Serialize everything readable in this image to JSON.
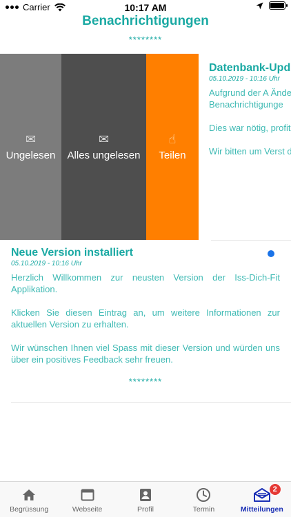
{
  "status_bar": {
    "carrier": "Carrier",
    "time": "10:17 AM"
  },
  "header": {
    "title": "Benachrichtigungen",
    "stars": "********"
  },
  "swipe_actions": [
    {
      "label": "Ungelesen",
      "icon": "envelope-icon",
      "color": "#7c7c7c"
    },
    {
      "label": "Alles ungelesen",
      "icon": "envelope-icon",
      "color": "#4e4e4e"
    },
    {
      "label": "Teilen",
      "icon": "hand-pointer-icon",
      "color": "#ff7f00"
    }
  ],
  "notifications": [
    {
      "title": "Datenbank-Upd",
      "date": "05.10.2019 - 10:16 Uhr",
      "body": [
        "Aufgrund der A Änderungen in vorgenommen wer Benachrichtigunge",
        "Dies war nötig, profitieren können.",
        "Wir bitten um Verst dieser Version."
      ]
    },
    {
      "title": "Neue Version installiert",
      "date": "05.10.2019 - 10:16 Uhr",
      "unread": true,
      "body": [
        "Herzlich Willkommen zur neusten Version der Iss-Dich-Fit Applikation.",
        "Klicken Sie diesen Eintrag an, um weitere Informationen zur aktuellen Version zu erhalten.",
        "Wir wünschen Ihnen viel Spass mit dieser Version und würden uns über ein positives Feedback sehr freuen."
      ],
      "stars": "********"
    }
  ],
  "tabs": [
    {
      "label": "Begrüssung",
      "icon": "home-icon",
      "active": false
    },
    {
      "label": "Webseite",
      "icon": "browser-window-icon",
      "active": false
    },
    {
      "label": "Profil",
      "icon": "profile-card-icon",
      "active": false
    },
    {
      "label": "Termin",
      "icon": "clock-icon",
      "active": false
    },
    {
      "label": "Mitteilungen",
      "icon": "mail-icon",
      "active": true,
      "badge": "2"
    }
  ],
  "colors": {
    "accent": "#1aa9a3",
    "tab_active": "#1a2fb5",
    "share_action": "#ff7f00",
    "badge": "#e53935",
    "unread_dot": "#1a73e8"
  }
}
